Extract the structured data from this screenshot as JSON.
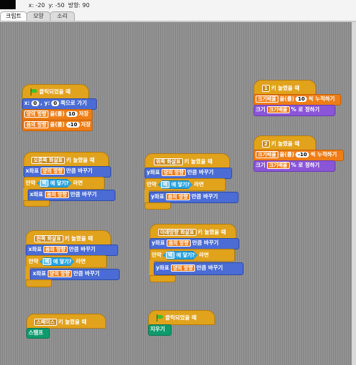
{
  "status": {
    "x_label": "x: -20",
    "y_label": "y: -50",
    "direction_label": "방향: 90"
  },
  "tabs": [
    {
      "label": "크립트"
    },
    {
      "label": "모양"
    },
    {
      "label": "소리"
    }
  ],
  "scripts": {
    "flag_script": {
      "hat": "클릭되었을 때",
      "goto": {
        "pre": "x:",
        "x": "0",
        "mid": ", y:",
        "y": "0",
        "post": "쪽으로 가기"
      },
      "set1": {
        "var": "양의 방향",
        "pre": "을(를)",
        "value": "10",
        "post": "저장"
      },
      "set2": {
        "var": "음의 방향",
        "pre": "을(를)",
        "value": "-10",
        "post": "저장"
      }
    },
    "key1_script": {
      "key": "1",
      "hat": "키 눌렸을 때",
      "change": {
        "var": "크기배율",
        "pre": "을(를)",
        "value": "10",
        "post": "씩 누적하기"
      },
      "size": {
        "pre": "크기",
        "var": "크기배율",
        "post": "% 로 정하기"
      }
    },
    "key2_script": {
      "key": "2",
      "hat": "키 눌렸을 때",
      "change": {
        "var": "크기배율",
        "pre": "을(를)",
        "value": "-10",
        "post": "씩 누적하기"
      },
      "size": {
        "pre": "크기",
        "var": "크기배율",
        "post": "% 로 정하기"
      }
    },
    "right_script": {
      "key": "오른쪽 화살표",
      "hat": "키 눌렸을 때",
      "move": {
        "pre": "x좌표",
        "var": "양의 방향",
        "post": "만큼 바꾸기"
      },
      "if": {
        "pre": "만약",
        "sensor": "벽",
        "sensor_text": "에 닿기?",
        "post": "라면"
      },
      "inner": {
        "pre": "x좌표",
        "var": "음의 방향",
        "post": "만큼 바꾸기"
      }
    },
    "up_script": {
      "key": "위쪽 화살표",
      "hat": "키 눌렸을 때",
      "move": {
        "pre": "y좌표",
        "var": "양의 방향",
        "post": "만큼 바꾸기"
      },
      "if": {
        "pre": "만약",
        "sensor": "벽",
        "sensor_text": "에 닿기?",
        "post": "라면"
      },
      "inner": {
        "pre": "y좌표",
        "var": "음의 방향",
        "post": "만큼 바꾸기"
      }
    },
    "left_script": {
      "key": "왼쪽 화살표",
      "hat": "키 눌렸을 때",
      "move": {
        "pre": "x좌표",
        "var": "음의 방향",
        "post": "만큼 바꾸기"
      },
      "if": {
        "pre": "만약",
        "sensor": "벽",
        "sensor_text": "에 닿기?",
        "post": "라면"
      },
      "inner": {
        "pre": "x좌표",
        "var": "양의 방향",
        "post": "만큼 바꾸기"
      }
    },
    "down_script": {
      "key": "아래방향 화살표",
      "hat": "키 눌렸을 때",
      "move": {
        "pre": "y좌표",
        "var": "음의 방향",
        "post": "만큼 바꾸기"
      },
      "if": {
        "pre": "만약",
        "sensor": "벽",
        "sensor_text": "에 닿기?",
        "post": "라면"
      },
      "inner": {
        "pre": "y좌표",
        "var": "양의 방향",
        "post": "만큼 바꾸기"
      }
    },
    "space_script": {
      "key": "스페이스",
      "hat": "키 눌렸을 때",
      "action": "스탬프"
    },
    "clear_script": {
      "hat": "클릭되었을 때",
      "action": "지우기"
    }
  },
  "icons": {
    "flag": "green-flag-icon",
    "dropdown": "dropdown-arrow-icon"
  },
  "colors": {
    "control": "#e1a21c",
    "motion": "#4a6cd4",
    "looks": "#8a55d7",
    "pen": "#0e9a6c",
    "sensing": "#2ca5e2",
    "variable": "#ee7d16"
  }
}
